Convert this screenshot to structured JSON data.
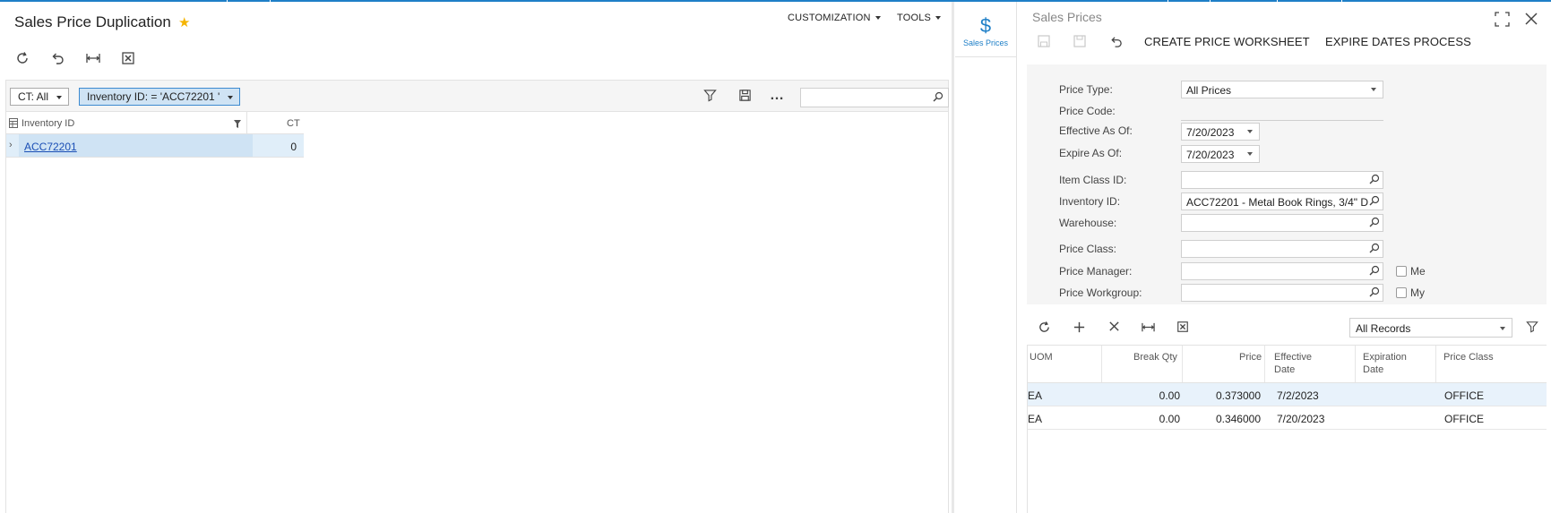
{
  "left": {
    "title": "Sales Price Duplication",
    "menu": {
      "customization": "CUSTOMIZATION",
      "tools": "TOOLS"
    },
    "toolbar": [
      "refresh-icon",
      "undo-icon",
      "fit-columns-icon",
      "excel-export-icon"
    ],
    "filters": {
      "ct_chip": "CT: All",
      "inventory_chip": "Inventory ID: = 'ACC72201 '"
    },
    "search": {
      "value": "",
      "placeholder": ""
    },
    "grid": {
      "columns": [
        "Inventory ID",
        "CT"
      ],
      "rows": [
        {
          "inventory_id": "ACC72201",
          "ct": "0"
        }
      ]
    }
  },
  "side_tab": {
    "label": "Sales Prices",
    "icon": "dollar-icon"
  },
  "panel": {
    "title": "Sales Prices",
    "actions": {
      "create_worksheet": "CREATE PRICE WORKSHEET",
      "expire_dates": "EXPIRE DATES PROCESS"
    },
    "form": {
      "price_type": {
        "label": "Price Type:",
        "value": "All Prices"
      },
      "price_code": {
        "label": "Price Code:",
        "value": ""
      },
      "effective_as_of": {
        "label": "Effective As Of:",
        "value": "7/20/2023"
      },
      "expire_as_of": {
        "label": "Expire As Of:",
        "value": "7/20/2023"
      },
      "item_class_id": {
        "label": "Item Class ID:",
        "value": ""
      },
      "inventory_id": {
        "label": "Inventory ID:",
        "value": "ACC72201 - Metal Book Rings, 3/4\" D"
      },
      "warehouse": {
        "label": "Warehouse:",
        "value": ""
      },
      "price_class": {
        "label": "Price Class:",
        "value": ""
      },
      "price_manager": {
        "label": "Price Manager:",
        "value": "",
        "checkbox": "Me"
      },
      "price_workgroup": {
        "label": "Price Workgroup:",
        "value": "",
        "checkbox": "My"
      }
    },
    "grid_toolbar": {
      "records_filter": "All Records"
    },
    "grid": {
      "columns": {
        "uom": "UOM",
        "break_qty": "Break Qty",
        "price": "Price",
        "effective_date": [
          "Effective",
          "Date"
        ],
        "expiration_date": [
          "Expiration",
          "Date"
        ],
        "price_class": "Price Class"
      },
      "rows": [
        {
          "uom": "EA",
          "break_qty": "0.00",
          "price": "0.373000",
          "effective_date": "7/2/2023",
          "expiration_date": "",
          "price_class": "OFFICE"
        },
        {
          "uom": "EA",
          "break_qty": "0.00",
          "price": "0.346000",
          "effective_date": "7/20/2023",
          "expiration_date": "",
          "price_class": "OFFICE"
        }
      ]
    }
  },
  "colors": {
    "accent": "#1e7fc7",
    "star": "#f5b400",
    "selection": "#cfe3f4",
    "link": "#1a4eb5"
  }
}
